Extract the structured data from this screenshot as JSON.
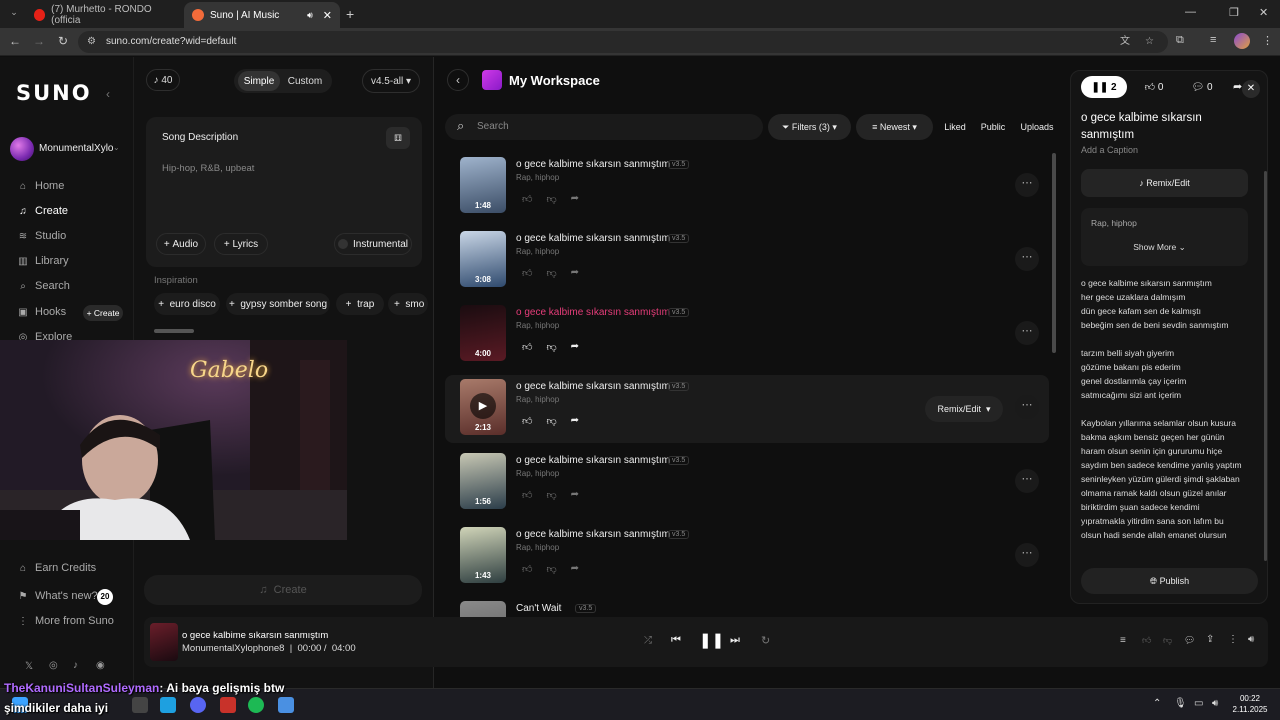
{
  "browser": {
    "tabs": [
      {
        "title": "(7) Murhetto - RONDO (officia",
        "color": "#e62117"
      },
      {
        "title": "Suno | AI Music",
        "color": "#f26b3a"
      }
    ],
    "url": "suno.com/create?wid=default"
  },
  "sidebar": {
    "logo": "SUNO",
    "user": "MonumentalXylo",
    "items": [
      {
        "label": "Home",
        "icon": "home-icon",
        "glyph": "⌂"
      },
      {
        "label": "Create",
        "icon": "music-note-icon",
        "glyph": "♫"
      },
      {
        "label": "Studio",
        "icon": "studio-icon",
        "glyph": "≋"
      },
      {
        "label": "Library",
        "icon": "library-icon",
        "glyph": "▥"
      },
      {
        "label": "Search",
        "icon": "search-icon",
        "glyph": "⌕"
      },
      {
        "label": "Hooks",
        "icon": "hooks-icon",
        "glyph": "▣"
      },
      {
        "label": "Explore",
        "icon": "explore-icon",
        "glyph": "◎"
      }
    ],
    "hooks_create": "+ Create",
    "bottom": [
      {
        "label": "Earn Credits",
        "glyph": "⌂"
      },
      {
        "label": "What's new?",
        "glyph": "⚑"
      },
      {
        "label": "More from Suno",
        "glyph": "⋮"
      }
    ],
    "whats_new_badge": "20"
  },
  "create": {
    "credits": "40",
    "mode_simple": "Simple",
    "mode_custom": "Custom",
    "model": "v4.5-all",
    "desc_label": "Song Description",
    "desc_placeholder": "Hip-hop, R&B, upbeat",
    "audio": "Audio",
    "lyrics": "Lyrics",
    "instrumental": "Instrumental",
    "inspiration": "Inspiration",
    "tags": [
      "euro disco",
      "gypsy somber song",
      "trap",
      "smo"
    ],
    "create_button": "Create"
  },
  "workspace": {
    "title": "My Workspace",
    "search_placeholder": "Search",
    "filters": "Filters (3)",
    "sort": "Newest",
    "chips": [
      "Liked",
      "Public",
      "Uploads"
    ],
    "songs": [
      {
        "title": "o gece kalbime sıkarsın sanmıştım",
        "version": "v3.5",
        "genre": "Rap, hiphop",
        "duration": "1:48",
        "c1": "#3b4d66",
        "c2": "#9fb3cc"
      },
      {
        "title": "o gece kalbime sıkarsın sanmıştım",
        "version": "v3.5",
        "genre": "Rap, hiphop",
        "duration": "3:08",
        "c1": "#2f4a6e",
        "c2": "#c9d6e6"
      },
      {
        "title": "o gece kalbime sıkarsın sanmıştım",
        "version": "v3.5",
        "genre": "Rap, hiphop",
        "duration": "4:00",
        "c1": "#5a1a24",
        "c2": "#1a0c10",
        "pink": true
      },
      {
        "title": "o gece kalbime sıkarsın sanmıştım",
        "version": "v3.5",
        "genre": "Rap, hiphop",
        "duration": "2:13",
        "c1": "#5a2e2a",
        "c2": "#a87a6a",
        "hover": true
      },
      {
        "title": "o gece kalbime sıkarsın sanmıştım",
        "version": "v3.5",
        "genre": "Rap, hiphop",
        "duration": "1:56",
        "c1": "#2b3d4a",
        "c2": "#c8c8b4"
      },
      {
        "title": "o gece kalbime sıkarsın sanmıştım",
        "version": "v3.5",
        "genre": "Rap, hiphop",
        "duration": "1:43",
        "c1": "#2e3e40",
        "c2": "#d0d4b8"
      },
      {
        "title": "Can't Wait",
        "version": "v3.5",
        "genre": "",
        "duration": "",
        "c1": "#5a5a5a",
        "c2": "#8a8a8a"
      }
    ],
    "remix_edit": "Remix/Edit"
  },
  "detail": {
    "plays": "2",
    "likes": "0",
    "comments": "0",
    "title": "o gece kalbime sıkarsın sanmıştım",
    "caption": "Add a Caption",
    "remix": "Remix/Edit",
    "tags": "Rap, hiphop",
    "show_more": "Show More",
    "lyrics": [
      "o gece kalbime sıkarsın sanmıştım\nher gece uzaklara dalmışım\ndün gece kafam sen de kalmıştı\nbebeğim sen de beni sevdin sanmıştım",
      "tarzım belli siyah giyerim\ngözüme bakanı pis ederim\ngenel dostlarımla çay içerim\nsatmıcağımı sizi ant içerim",
      "Kaybolan yıllarıma selamlar olsun kusura\nbakma aşkım bensiz geçen her günün\nharam olsun senin için gururumu hiçe\nsaydım ben sadece kendime yanlış yaptım\nseninleyken yüzüm gülerdi şimdi şaklaban\nolmama ramak kaldı olsun güzel anılar\nbiriktirdim şuan sadece kendimi\nyıpratmakla yitirdim sana son lafım bu\nolsun hadi sende allah emanet olursun"
    ],
    "publish": "Publish"
  },
  "player": {
    "title": "o gece kalbime sıkarsın sanmıştım",
    "artist": "MonumentalXylophone8",
    "time": "00:00",
    "total": "04:00"
  },
  "stream": {
    "chat_user": "TheKanuniSultanSuleyman",
    "chat_msg": ": Ai baya gelişmiş btw",
    "chat_line2": "şimdikiler daha iyi",
    "neon": "Gabelo"
  },
  "taskbar": {
    "time": "00:22",
    "date": "2.11.2025"
  }
}
